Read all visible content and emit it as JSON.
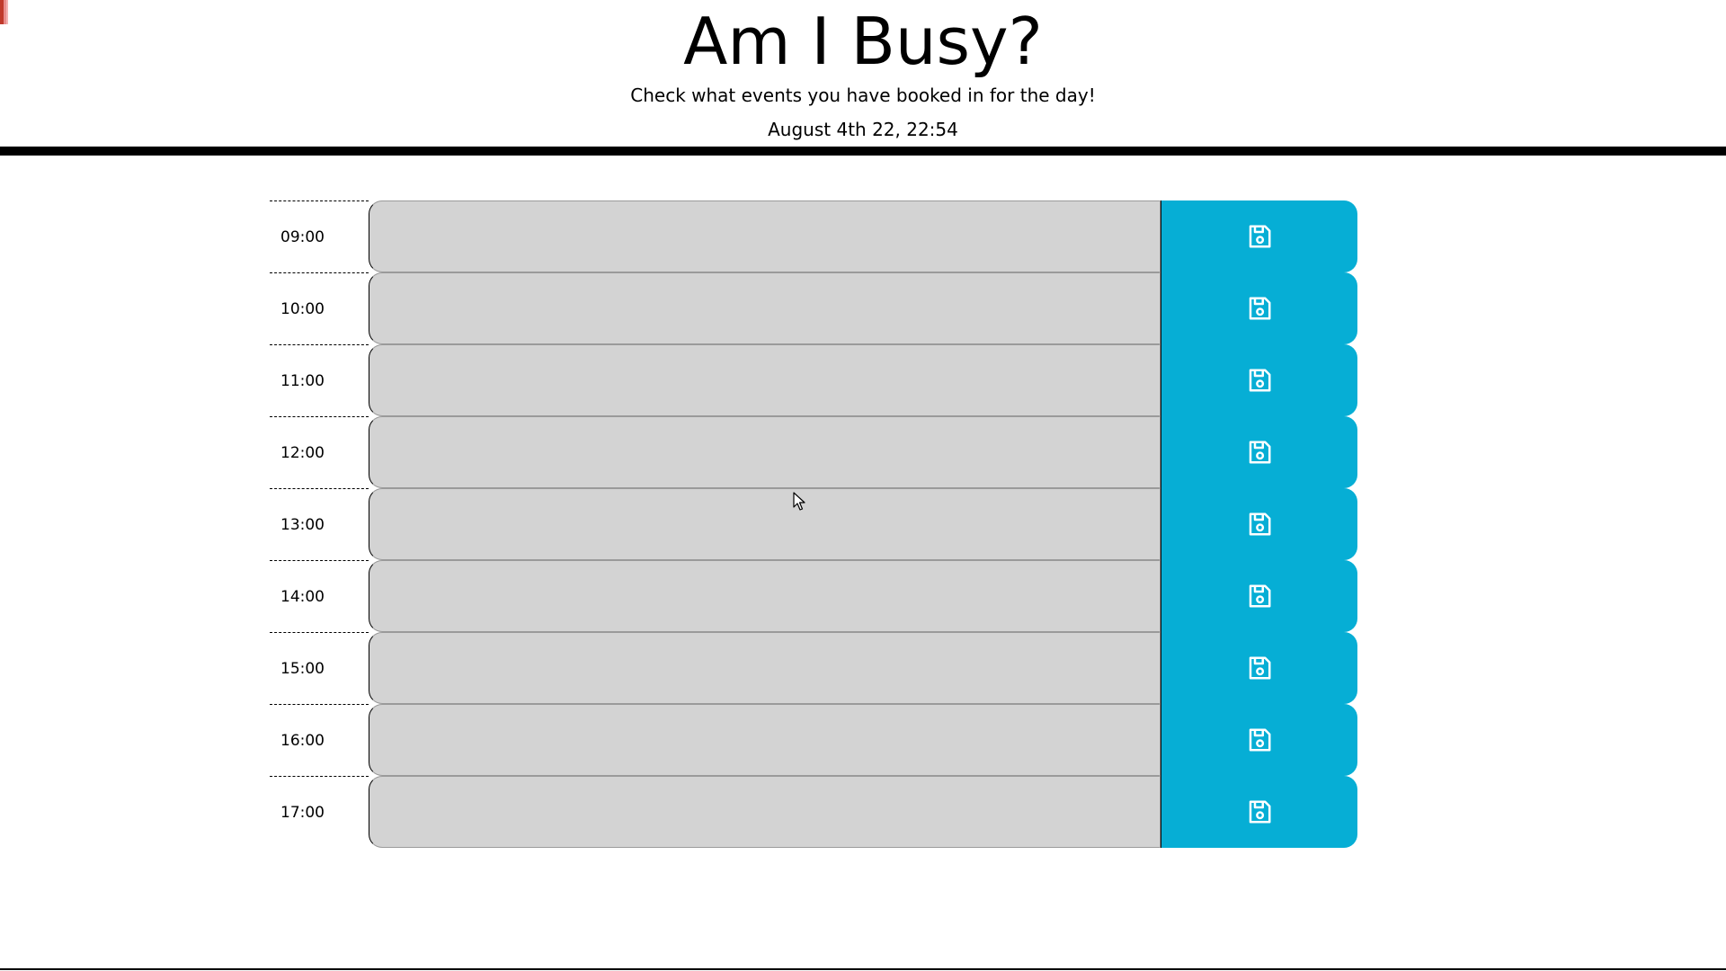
{
  "header": {
    "title": "Am I Busy?",
    "subtitle": "Check what events you have booked in for the day!",
    "current_day": "August 4th 22, 22:54"
  },
  "colors": {
    "save_button": "#06aed5",
    "textarea_background": "#d3d3d3",
    "divider": "#000000"
  },
  "icons": {
    "save": "floppy-disk-icon",
    "cursor": "mouse-pointer-icon"
  },
  "schedule": {
    "rows": [
      {
        "hour": "09:00",
        "text": ""
      },
      {
        "hour": "10:00",
        "text": ""
      },
      {
        "hour": "11:00",
        "text": ""
      },
      {
        "hour": "12:00",
        "text": ""
      },
      {
        "hour": "13:00",
        "text": ""
      },
      {
        "hour": "14:00",
        "text": ""
      },
      {
        "hour": "15:00",
        "text": ""
      },
      {
        "hour": "16:00",
        "text": ""
      },
      {
        "hour": "17:00",
        "text": ""
      }
    ]
  }
}
